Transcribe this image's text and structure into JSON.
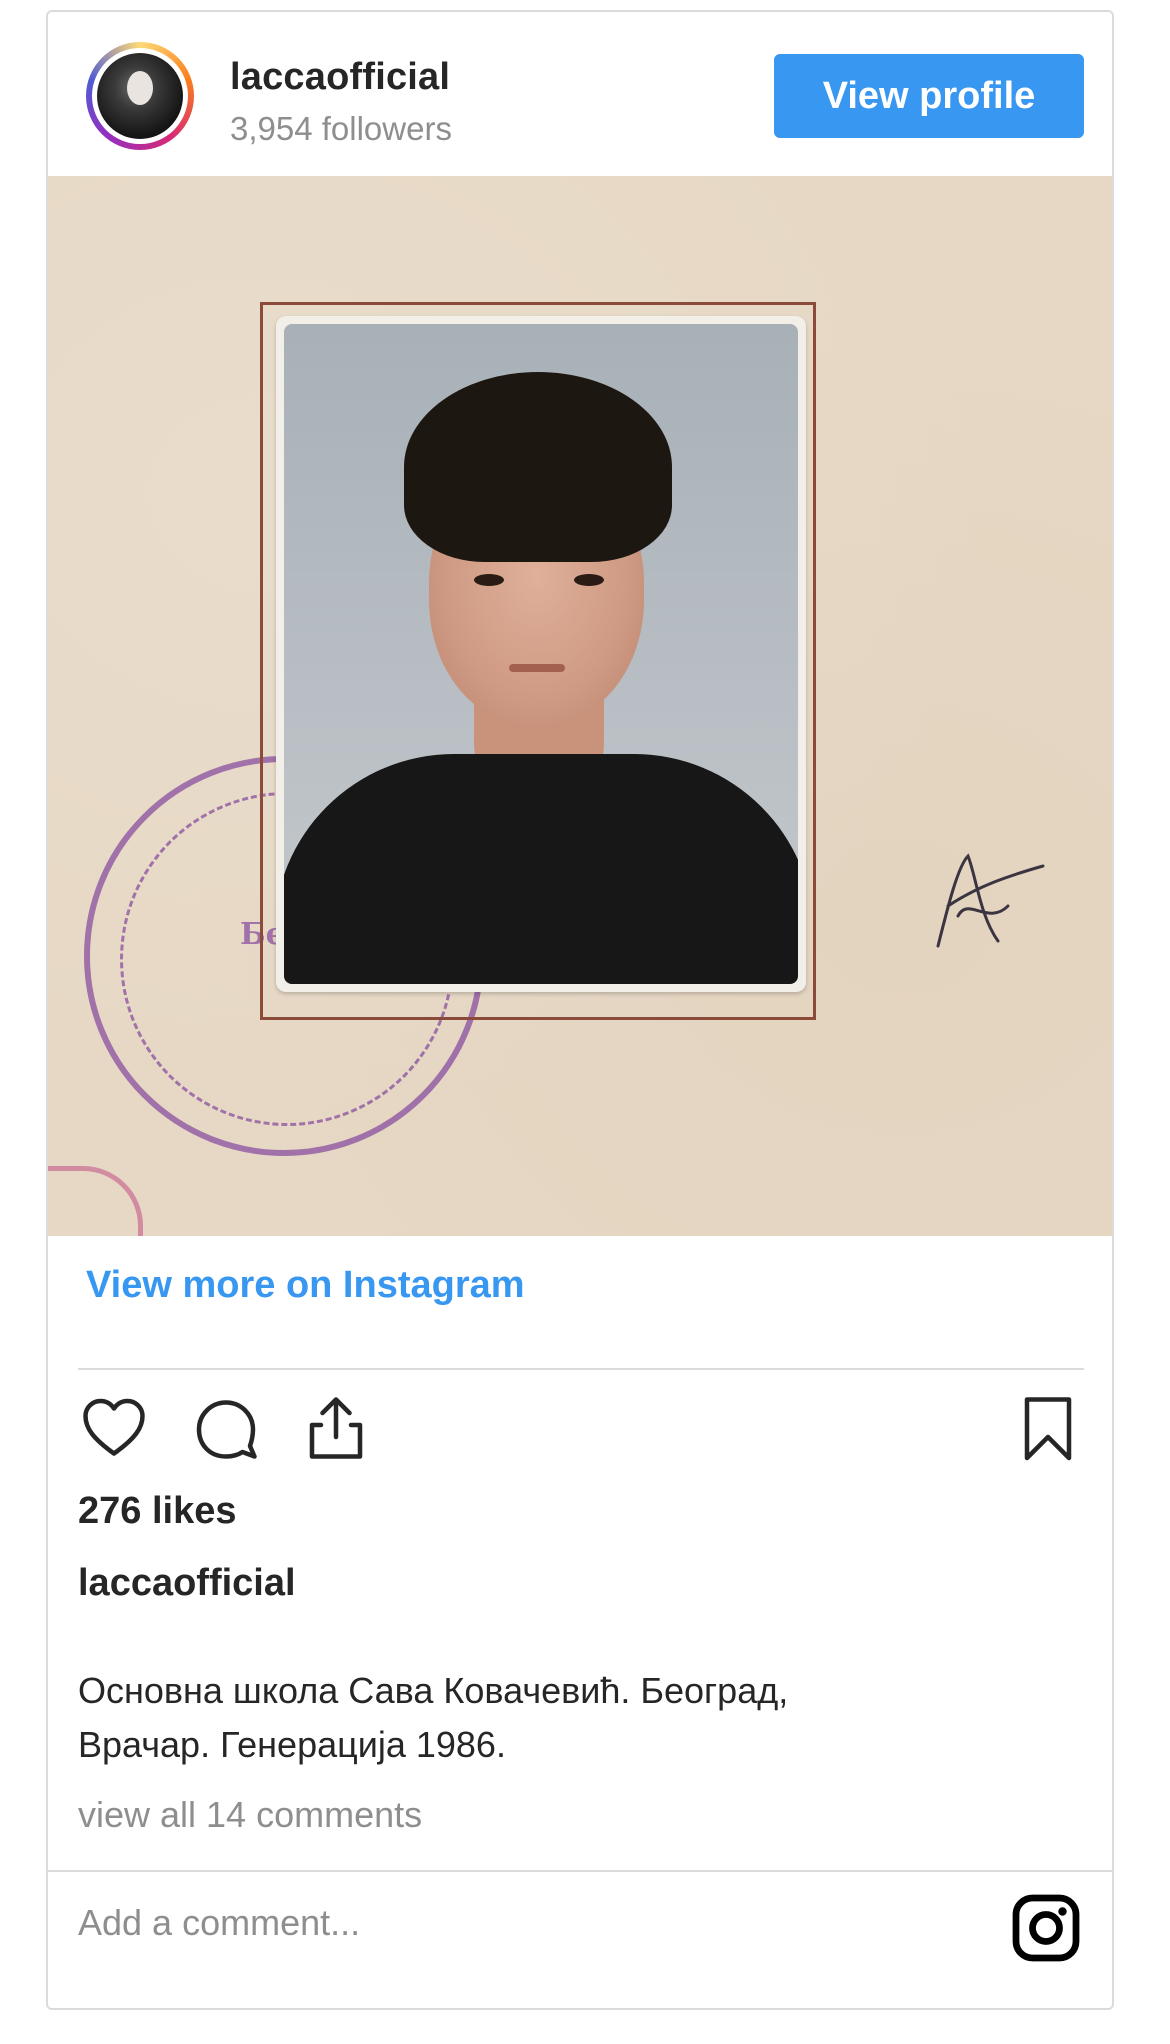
{
  "header": {
    "username": "laccaofficial",
    "followers": "3,954 followers",
    "view_profile_label": "View profile"
  },
  "photo": {
    "stamp_text": "Бео"
  },
  "links": {
    "view_more": "View more on Instagram"
  },
  "actions": {
    "icons": [
      "heart-icon",
      "comment-icon",
      "share-icon",
      "bookmark-icon"
    ]
  },
  "post": {
    "likes": "276 likes",
    "caption_user": "laccaofficial",
    "caption_line1": "Основна школа Сава Ковачевић. Београд,",
    "caption_line2": "Врачар. Генерација 1986.",
    "comments_link": "view all 14 comments"
  },
  "comment_box": {
    "placeholder": "Add a comment..."
  },
  "colors": {
    "accent": "#3897f0",
    "text": "#262626",
    "muted": "#8e8e8e",
    "border": "#dbdbdb"
  }
}
